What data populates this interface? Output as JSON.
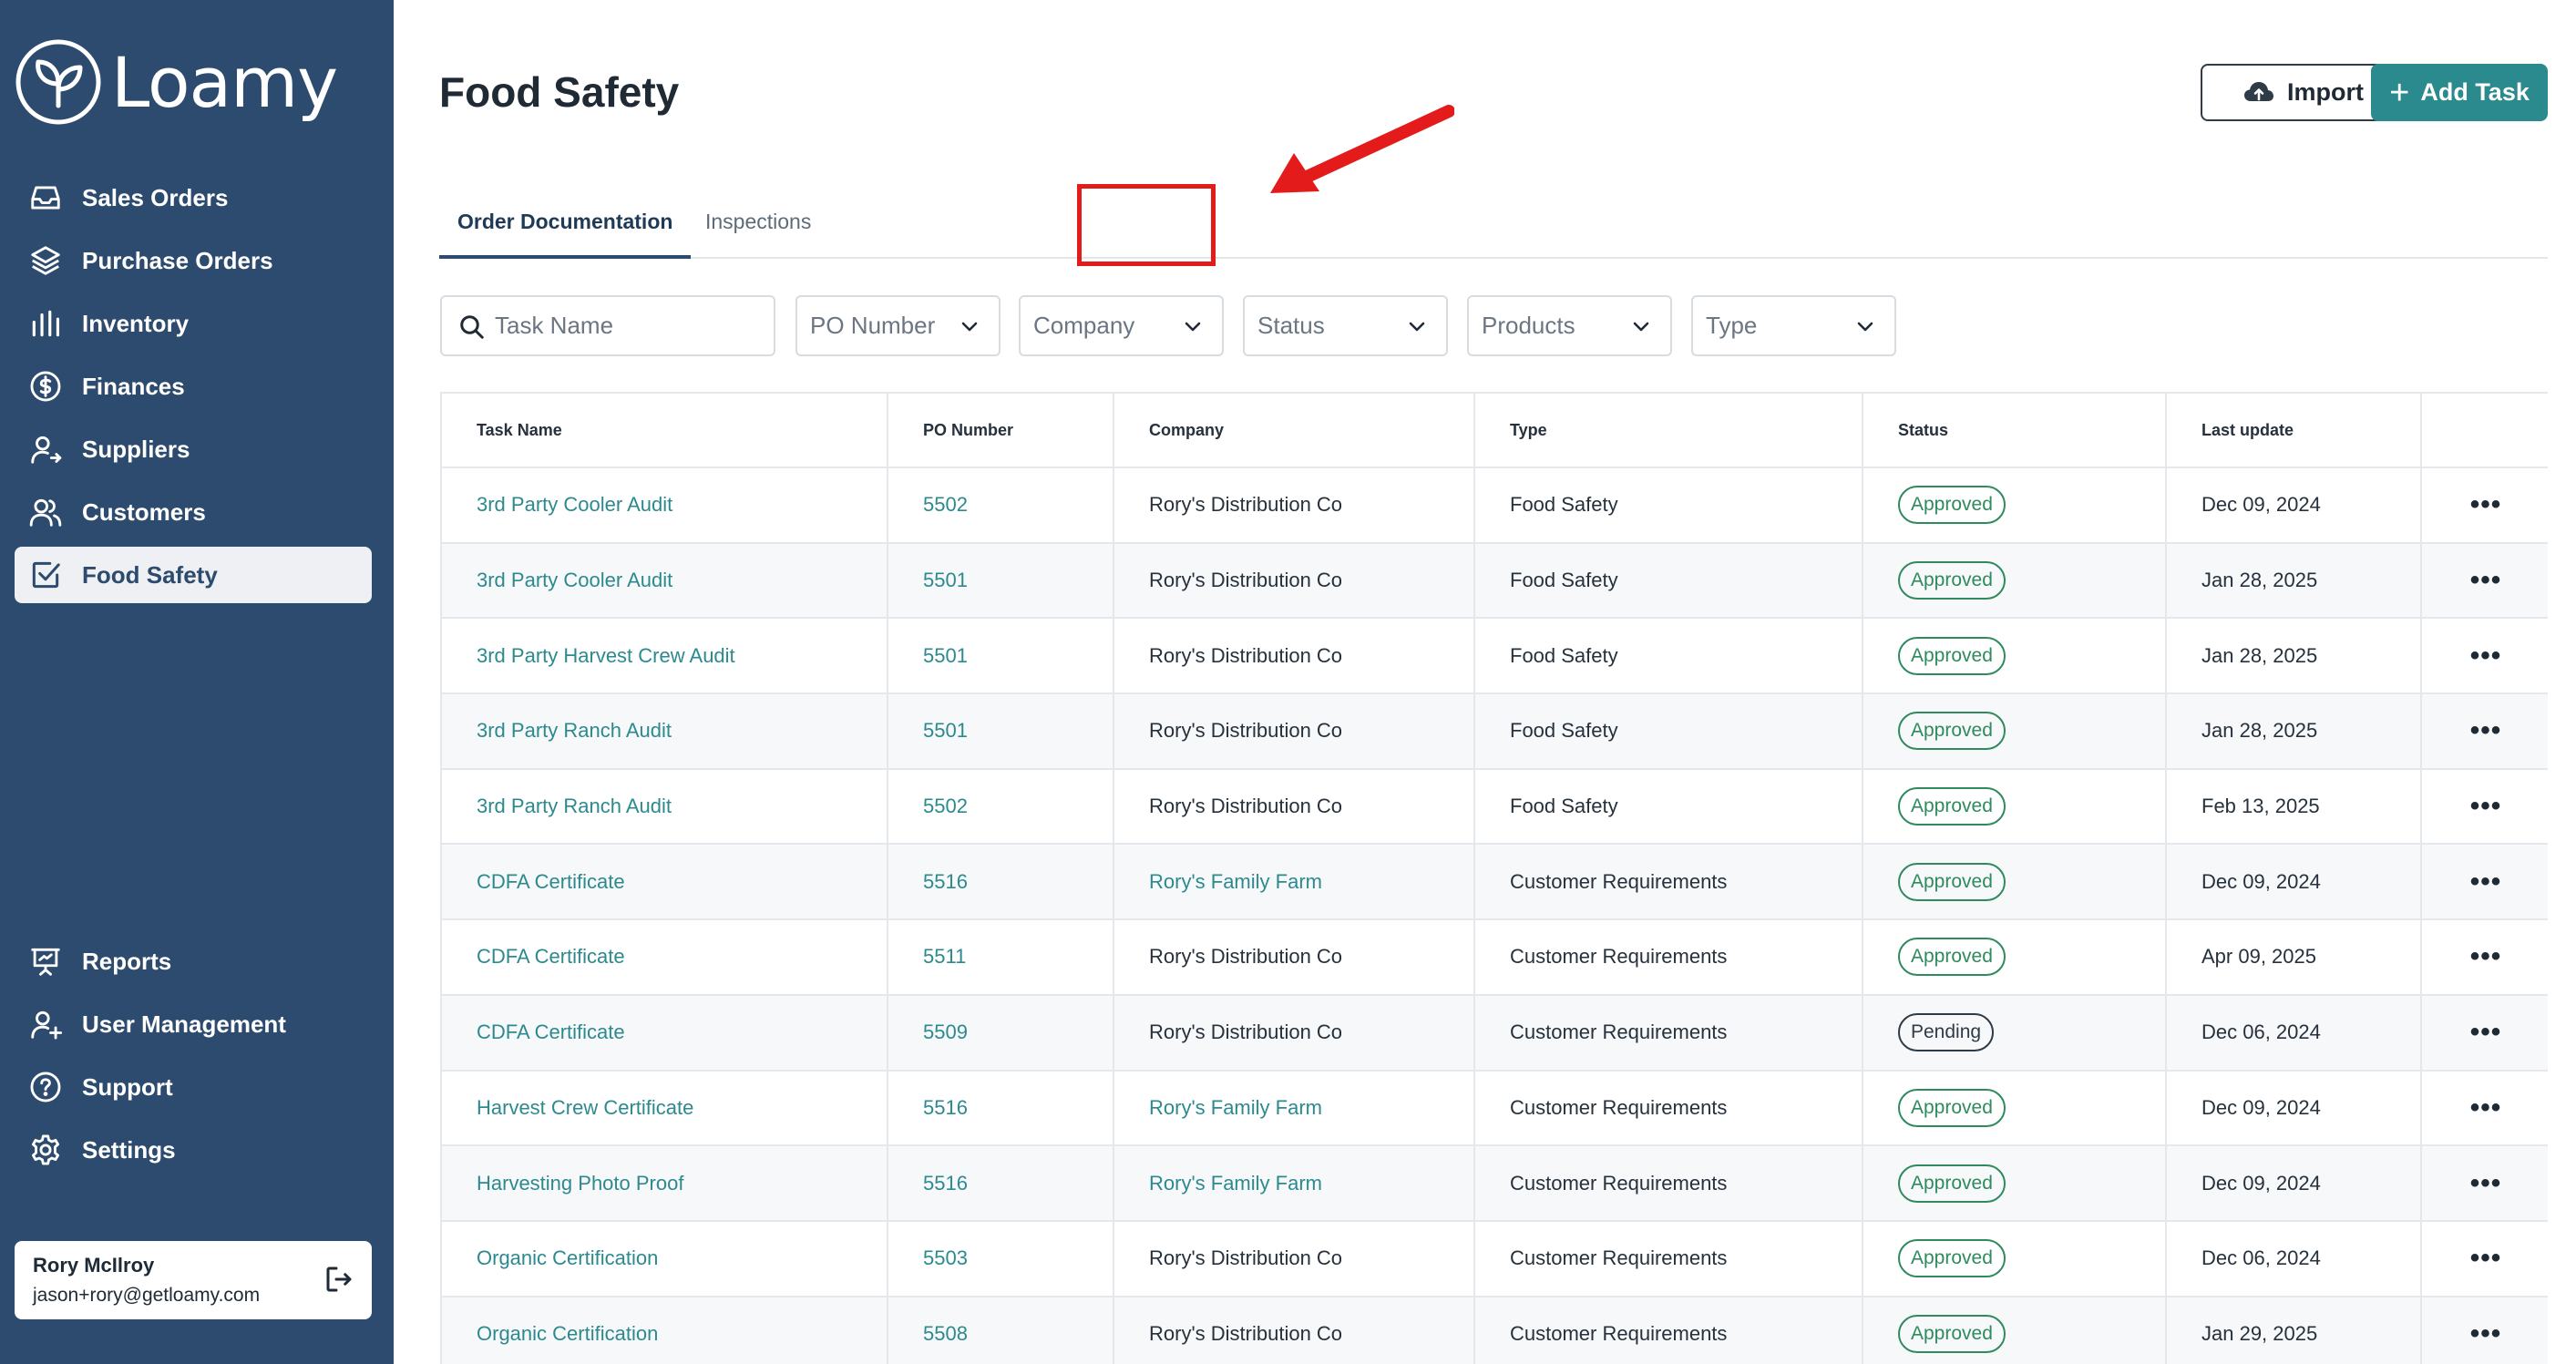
{
  "brand": {
    "name": "Loamy"
  },
  "sidebar": {
    "items": [
      {
        "label": "Sales Orders",
        "icon": "inbox-icon"
      },
      {
        "label": "Purchase Orders",
        "icon": "layers-icon"
      },
      {
        "label": "Inventory",
        "icon": "bar-chart-icon"
      },
      {
        "label": "Finances",
        "icon": "dollar-icon"
      },
      {
        "label": "Suppliers",
        "icon": "user-arrow-icon"
      },
      {
        "label": "Customers",
        "icon": "users-icon"
      },
      {
        "label": "Food Safety",
        "icon": "checkbox-icon",
        "active": true
      }
    ],
    "bottom_items": [
      {
        "label": "Reports",
        "icon": "presentation-icon"
      },
      {
        "label": "User Management",
        "icon": "user-plus-icon"
      },
      {
        "label": "Support",
        "icon": "help-icon"
      },
      {
        "label": "Settings",
        "icon": "gear-icon"
      }
    ],
    "user": {
      "name": "Rory McIlroy",
      "email": "jason+rory@getloamy.com"
    }
  },
  "header": {
    "title": "Food Safety",
    "import_label": "Import",
    "add_label": "Add Task"
  },
  "tabs": [
    {
      "label": "Order Documentation",
      "active": true
    },
    {
      "label": "Inspections",
      "active": false
    }
  ],
  "filters": {
    "task_placeholder": "Task Name",
    "po": "PO Number",
    "company": "Company",
    "status": "Status",
    "products": "Products",
    "type": "Type"
  },
  "table": {
    "columns": [
      "Task Name",
      "PO Number",
      "Company",
      "Type",
      "Status",
      "Last update"
    ],
    "rows": [
      {
        "task": "3rd Party Cooler Audit",
        "po": "5502",
        "company": "Rory's Distribution Co",
        "company_link": false,
        "type": "Food Safety",
        "status": "Approved",
        "updated": "Dec 09, 2024"
      },
      {
        "task": "3rd Party Cooler Audit",
        "po": "5501",
        "company": "Rory's Distribution Co",
        "company_link": false,
        "type": "Food Safety",
        "status": "Approved",
        "updated": "Jan 28, 2025"
      },
      {
        "task": "3rd Party Harvest Crew Audit",
        "po": "5501",
        "company": "Rory's Distribution Co",
        "company_link": false,
        "type": "Food Safety",
        "status": "Approved",
        "updated": "Jan 28, 2025"
      },
      {
        "task": "3rd Party Ranch Audit",
        "po": "5501",
        "company": "Rory's Distribution Co",
        "company_link": false,
        "type": "Food Safety",
        "status": "Approved",
        "updated": "Jan 28, 2025"
      },
      {
        "task": "3rd Party Ranch Audit",
        "po": "5502",
        "company": "Rory's Distribution Co",
        "company_link": false,
        "type": "Food Safety",
        "status": "Approved",
        "updated": "Feb 13, 2025"
      },
      {
        "task": "CDFA Certificate",
        "po": "5516",
        "company": "Rory's Family Farm",
        "company_link": true,
        "type": "Customer Requirements",
        "status": "Approved",
        "updated": "Dec 09, 2024"
      },
      {
        "task": "CDFA Certificate",
        "po": "5511",
        "company": "Rory's Distribution Co",
        "company_link": false,
        "type": "Customer Requirements",
        "status": "Approved",
        "updated": "Apr 09, 2025"
      },
      {
        "task": "CDFA Certificate",
        "po": "5509",
        "company": "Rory's Distribution Co",
        "company_link": false,
        "type": "Customer Requirements",
        "status": "Pending",
        "updated": "Dec 06, 2024"
      },
      {
        "task": "Harvest Crew Certificate",
        "po": "5516",
        "company": "Rory's Family Farm",
        "company_link": true,
        "type": "Customer Requirements",
        "status": "Approved",
        "updated": "Dec 09, 2024"
      },
      {
        "task": "Harvesting Photo Proof",
        "po": "5516",
        "company": "Rory's Family Farm",
        "company_link": true,
        "type": "Customer Requirements",
        "status": "Approved",
        "updated": "Dec 09, 2024"
      },
      {
        "task": "Organic Certification",
        "po": "5503",
        "company": "Rory's Distribution Co",
        "company_link": false,
        "type": "Customer Requirements",
        "status": "Approved",
        "updated": "Dec 06, 2024"
      },
      {
        "task": "Organic Certification",
        "po": "5508",
        "company": "Rory's Distribution Co",
        "company_link": false,
        "type": "Customer Requirements",
        "status": "Approved",
        "updated": "Jan 29, 2025"
      }
    ]
  },
  "colors": {
    "sidebar_bg": "#2d4b6e",
    "accent": "#2a8a8d",
    "approved": "#2f8a5e",
    "highlight": "#e31b1b"
  }
}
